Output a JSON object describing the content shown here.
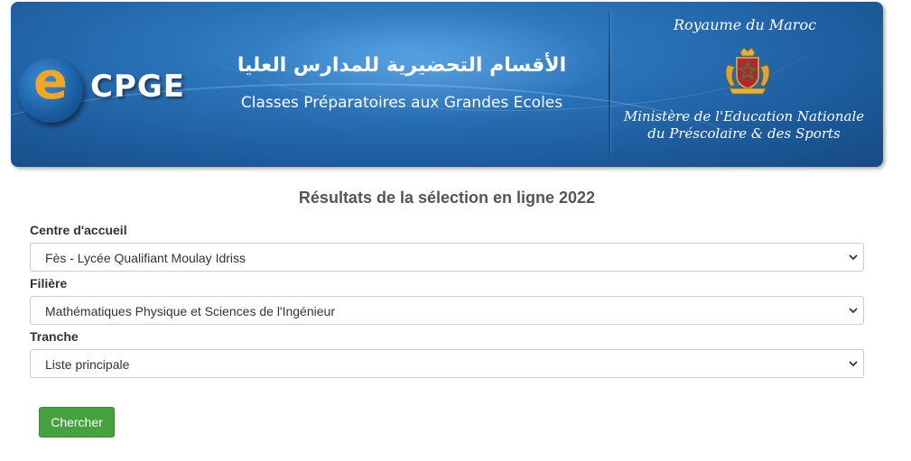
{
  "header": {
    "logo_letter": "e",
    "logo_text": "CPGE",
    "title_ar": "الأقسام التحضيرية للمدارس العليا",
    "title_fr": "Classes Préparatoires aux Grandes Ecoles",
    "kingdom": "Royaume du Maroc",
    "ministry_line1": "Ministère de l'Education Nationale",
    "ministry_line2": "du Préscolaire & des Sports"
  },
  "form": {
    "heading": "Résultats de la sélection en ligne 2022",
    "centre_label": "Centre d'accueil",
    "centre_value": "Fès - Lycée Qualifiant Moulay Idriss",
    "filiere_label": "Filière",
    "filiere_value": "Mathématiques Physique et Sciences de l'Ingénieur",
    "tranche_label": "Tranche",
    "tranche_value": "Liste principale",
    "submit_label": "Chercher"
  },
  "colors": {
    "banner_blue": "#2a72b8",
    "logo_orange": "#f5a623",
    "button_green": "#46a23f"
  },
  "icons": {
    "logo": "e-logo-icon",
    "emblem": "coat-of-arms-icon",
    "dropdown": "chevron-down-icon"
  }
}
